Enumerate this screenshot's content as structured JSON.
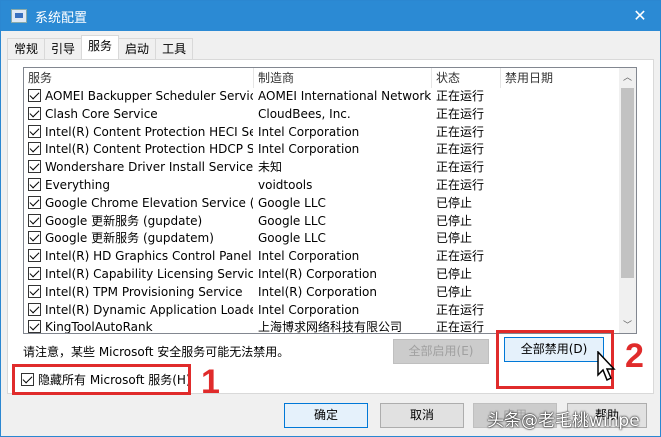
{
  "window": {
    "title": "系统配置",
    "close": "✕"
  },
  "tabs": [
    "常规",
    "引导",
    "服务",
    "启动",
    "工具"
  ],
  "columns": [
    "服务",
    "制造商",
    "状态",
    "禁用日期"
  ],
  "rows": [
    {
      "service": "AOMEI Backupper Scheduler Service",
      "vendor": "AOMEI International Network...",
      "status": "正在运行",
      "date": ""
    },
    {
      "service": "Clash Core Service",
      "vendor": "CloudBees, Inc.",
      "status": "正在运行",
      "date": ""
    },
    {
      "service": "Intel(R) Content Protection HECI Ser...",
      "vendor": "Intel Corporation",
      "status": "正在运行",
      "date": ""
    },
    {
      "service": "Intel(R) Content Protection HDCP Se...",
      "vendor": "Intel Corporation",
      "status": "正在运行",
      "date": ""
    },
    {
      "service": "Wondershare Driver Install Service wx",
      "vendor": "未知",
      "status": "正在运行",
      "date": ""
    },
    {
      "service": "Everything",
      "vendor": "voidtools",
      "status": "正在运行",
      "date": ""
    },
    {
      "service": "Google Chrome Elevation Service (G...",
      "vendor": "Google LLC",
      "status": "已停止",
      "date": ""
    },
    {
      "service": "Google 更新服务 (gupdate)",
      "vendor": "Google LLC",
      "status": "已停止",
      "date": ""
    },
    {
      "service": "Google 更新服务 (gupdatem)",
      "vendor": "Google LLC",
      "status": "已停止",
      "date": ""
    },
    {
      "service": "Intel(R) HD Graphics Control Panel S...",
      "vendor": "Intel Corporation",
      "status": "正在运行",
      "date": ""
    },
    {
      "service": "Intel(R) Capability Licensing Service ...",
      "vendor": "Intel(R) Corporation",
      "status": "已停止",
      "date": ""
    },
    {
      "service": "Intel(R) TPM Provisioning Service",
      "vendor": "Intel(R) Corporation",
      "status": "已停止",
      "date": ""
    },
    {
      "service": "Intel(R) Dynamic Application Loader...",
      "vendor": "Intel Corporation",
      "status": "正在运行",
      "date": ""
    },
    {
      "service": "KingToolAutoRank",
      "vendor": "上海博求网络科技有限公司",
      "status": "正在运行",
      "date": ""
    }
  ],
  "note": "请注意，某些 Microsoft 安全服务可能无法禁用。",
  "enable_all": "全部启用(E)",
  "disable_all": "全部禁用(D)",
  "hide_ms": "隐藏所有 Microsoft 服务(H)",
  "annotations": [
    "1",
    "2"
  ],
  "ok": "确定",
  "cancel": "取消",
  "apply": "应用",
  "help": "帮助",
  "watermark": "头条@老毛桃winpe",
  "accent": "#2b8ad4",
  "annotation_color": "#e02b2b"
}
